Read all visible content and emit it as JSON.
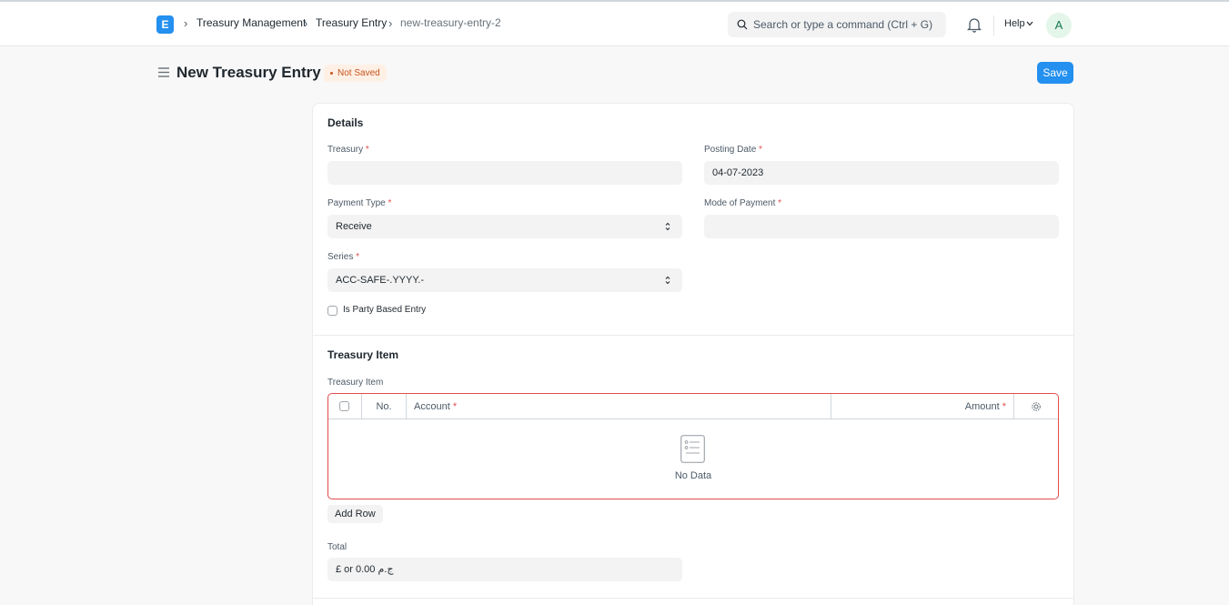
{
  "navbar": {
    "logo_letter": "E",
    "breadcrumbs": [
      "Treasury Management",
      "Treasury Entry",
      "new-treasury-entry-2"
    ],
    "search_placeholder": "Search or type a command (Ctrl + G)",
    "help_label": "Help",
    "avatar_initial": "A"
  },
  "page": {
    "title": "New Treasury Entry",
    "status_badge": "Not Saved",
    "save_label": "Save"
  },
  "details": {
    "section_title": "Details",
    "treasury": {
      "label": "Treasury",
      "value": ""
    },
    "posting_date": {
      "label": "Posting Date",
      "value": "04-07-2023"
    },
    "payment_type": {
      "label": "Payment Type",
      "value": "Receive"
    },
    "mode_of_payment": {
      "label": "Mode of Payment",
      "value": ""
    },
    "series": {
      "label": "Series",
      "value": "ACC-SAFE-.YYYY.-"
    },
    "is_party_based": {
      "label": "Is Party Based Entry",
      "checked": false
    }
  },
  "treasury_item": {
    "section_title": "Treasury Item",
    "table_label": "Treasury Item",
    "columns": {
      "no": "No.",
      "account": "Account",
      "amount": "Amount"
    },
    "empty_text": "No Data",
    "add_row_label": "Add Row",
    "total": {
      "label": "Total",
      "value": "£ or 0.00 ج.م"
    }
  },
  "colors": {
    "primary": "#2490ef",
    "required": "#e24c4c",
    "badge_text": "#c4541a",
    "badge_bg": "#fff0e6"
  }
}
